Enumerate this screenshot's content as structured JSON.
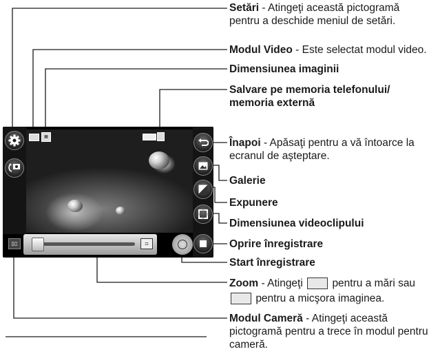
{
  "labels": {
    "setari": {
      "title": "Setări",
      "desc": " - Atingeţi această pictogramă",
      "desc2": "pentru a deschide meniul de setări."
    },
    "video": {
      "title": "Modul Video",
      "desc": " - Este selectat modul video."
    },
    "imagesize": {
      "title": "Dimensiunea imaginii"
    },
    "storage": {
      "title": "Salvare pe memoria telefonului/",
      "title2": "memoria externă"
    },
    "back": {
      "title": "Înapoi",
      "desc": " - Apăsaţi pentru a vă întoarce la",
      "desc2": "ecranul de aşteptare."
    },
    "gallery": {
      "title": "Galerie"
    },
    "exposure": {
      "title": "Expunere"
    },
    "videosize": {
      "title": "Dimensiunea videoclipului"
    },
    "stop": {
      "title": "Oprire înregistrare"
    },
    "start": {
      "title": "Start înregistrare"
    },
    "zoom": {
      "title": "Zoom",
      "desc": " - Atingeţi",
      "desc_mid": "pentru a mări sau",
      "desc2": "pentru a micşora imaginea."
    },
    "camera": {
      "title": "Modul Cameră",
      "desc": " - Atingeţi această",
      "desc2": "pictogramă pentru a trece în modul pentru",
      "desc3": "cameră."
    }
  },
  "icons": [
    "gear-icon",
    "camera-switch-icon",
    "back-arrow-icon",
    "gallery-icon",
    "exposure-icon",
    "video-size-icon",
    "stop-icon",
    "record-icon",
    "zoom-in-icon",
    "zoom-out-icon",
    "battery-icon",
    "memory-icon",
    "video-mode-icon",
    "image-size-icon"
  ],
  "colors": {
    "line": "#1a1a1a",
    "screen": "#000000"
  }
}
